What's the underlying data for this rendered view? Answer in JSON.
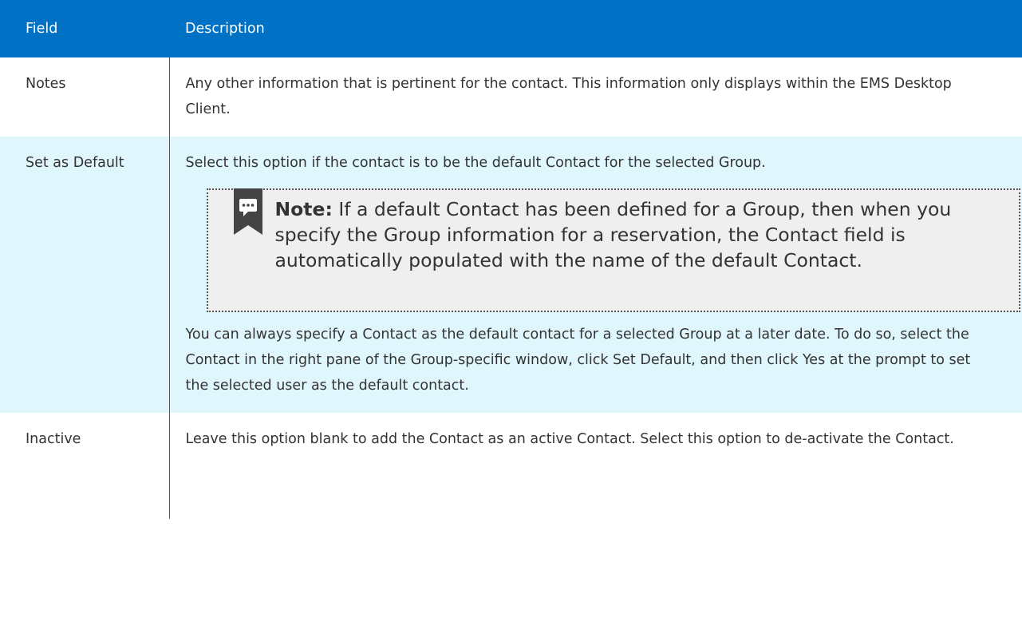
{
  "table": {
    "header": {
      "field": "Field",
      "description": "Description"
    },
    "rows": [
      {
        "field": "Notes",
        "description": "Any other information that is pertinent for the contact. This information only displays within the EMS Desktop Client."
      },
      {
        "field": "Set as Default",
        "description": "Select this option if the contact is to be the default Contact for the selected Group.",
        "note": {
          "label": "Note:",
          "text": " If a default Contact has been defined for a Group, then when you specify the Group information for a reservation, the Contact field is automatically populated with the name of the default Contact.",
          "icon": "comment-bookmark-icon"
        },
        "description_after": "You can always specify a Contact as the default contact for a selected Group at a later date. To do so, select the Contact in the right pane of the Group-specific window, click Set Default, and then click Yes at the prompt to set the selected user as the default contact."
      },
      {
        "field": "Inactive",
        "description": "Leave this option blank to add the Contact as an active Contact. Select this option to de-activate the Contact."
      }
    ]
  },
  "colors": {
    "header_bg": "#0072c6",
    "highlight_row_bg": "#dff6fc",
    "note_bg": "#efefef",
    "icon_color": "#444444"
  }
}
